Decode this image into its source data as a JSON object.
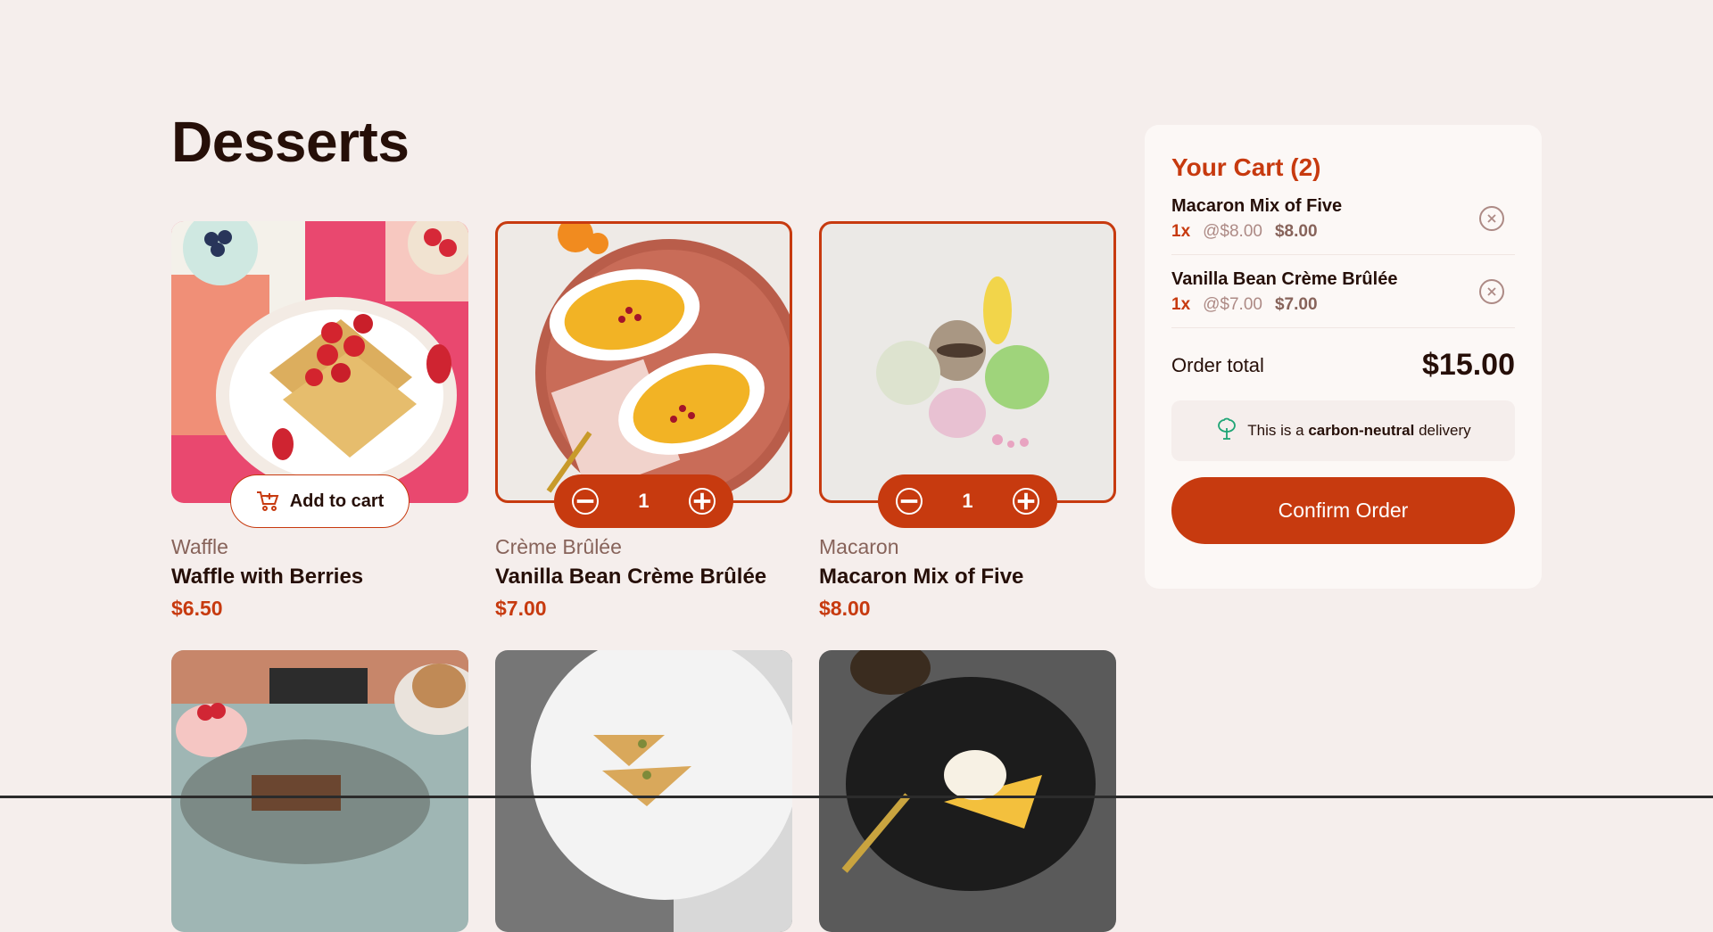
{
  "page": {
    "title": "Desserts"
  },
  "products": [
    {
      "category": "Waffle",
      "name": "Waffle with Berries",
      "price": "$6.50",
      "in_cart": false,
      "add_label": "Add to cart"
    },
    {
      "category": "Crème Brûlée",
      "name": "Vanilla Bean Crème Brûlée",
      "price": "$7.00",
      "in_cart": true,
      "quantity": "1"
    },
    {
      "category": "Macaron",
      "name": "Macaron Mix of Five",
      "price": "$8.00",
      "in_cart": true,
      "quantity": "1"
    },
    {
      "category": "",
      "name": "",
      "price": ""
    },
    {
      "category": "",
      "name": "",
      "price": ""
    },
    {
      "category": "",
      "name": "",
      "price": ""
    }
  ],
  "cart": {
    "title": "Your Cart (2)",
    "items": [
      {
        "name": "Macaron Mix of Five",
        "qty": "1x",
        "unit_price": "@$8.00",
        "total": "$8.00"
      },
      {
        "name": "Vanilla Bean Crème Brûlée",
        "qty": "1x",
        "unit_price": "@$7.00",
        "total": "$7.00"
      }
    ],
    "order_total_label": "Order total",
    "order_total": "$15.00",
    "carbon_prefix": "This is a",
    "carbon_bold": "carbon-neutral",
    "carbon_suffix": "delivery",
    "confirm_label": "Confirm Order"
  },
  "colors": {
    "accent": "#c73a0f",
    "background": "#f5eeec",
    "text": "#260f08",
    "muted": "#87635a",
    "green": "#1ea575"
  },
  "icons": [
    "cart-add-icon",
    "minus-icon",
    "plus-icon",
    "remove-item-icon",
    "carbon-neutral-tree-icon"
  ]
}
